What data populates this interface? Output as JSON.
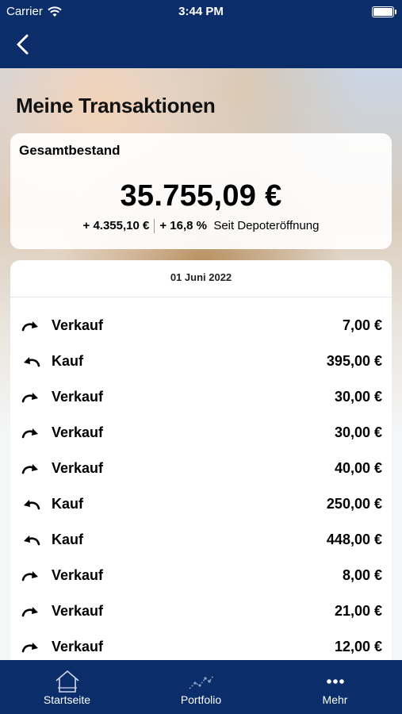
{
  "status_bar": {
    "carrier": "Carrier",
    "time": "3:44 PM"
  },
  "header": {
    "title": "Meine Transaktionen"
  },
  "total": {
    "label": "Gesamtbestand",
    "value": "35.755,09 €",
    "change_abs": "+ 4.355,10 €",
    "change_pct": "+ 16,8 %",
    "since": "Seit Depoteröffnung"
  },
  "transactions": {
    "date": "01 Juni 2022",
    "rows": [
      {
        "type": "Verkauf",
        "amount": "7,00 €",
        "icon": "arrow-forward-icon"
      },
      {
        "type": "Kauf",
        "amount": "395,00 €",
        "icon": "arrow-back-icon"
      },
      {
        "type": "Verkauf",
        "amount": "30,00 €",
        "icon": "arrow-forward-icon"
      },
      {
        "type": "Verkauf",
        "amount": "30,00 €",
        "icon": "arrow-forward-icon"
      },
      {
        "type": "Verkauf",
        "amount": "40,00 €",
        "icon": "arrow-forward-icon"
      },
      {
        "type": "Kauf",
        "amount": "250,00 €",
        "icon": "arrow-back-icon"
      },
      {
        "type": "Kauf",
        "amount": "448,00 €",
        "icon": "arrow-back-icon"
      },
      {
        "type": "Verkauf",
        "amount": "8,00 €",
        "icon": "arrow-forward-icon"
      },
      {
        "type": "Verkauf",
        "amount": "21,00 €",
        "icon": "arrow-forward-icon"
      },
      {
        "type": "Verkauf",
        "amount": "12,00 €",
        "icon": "arrow-forward-icon"
      }
    ]
  },
  "tabbar": {
    "items": [
      {
        "label": "Startseite",
        "icon": "home-icon"
      },
      {
        "label": "Portfolio",
        "icon": "chart-line-icon"
      },
      {
        "label": "Mehr",
        "icon": "more-dots-icon"
      }
    ]
  },
  "colors": {
    "brand": "#0b2e6b",
    "card": "#ffffff",
    "text": "#000000"
  }
}
